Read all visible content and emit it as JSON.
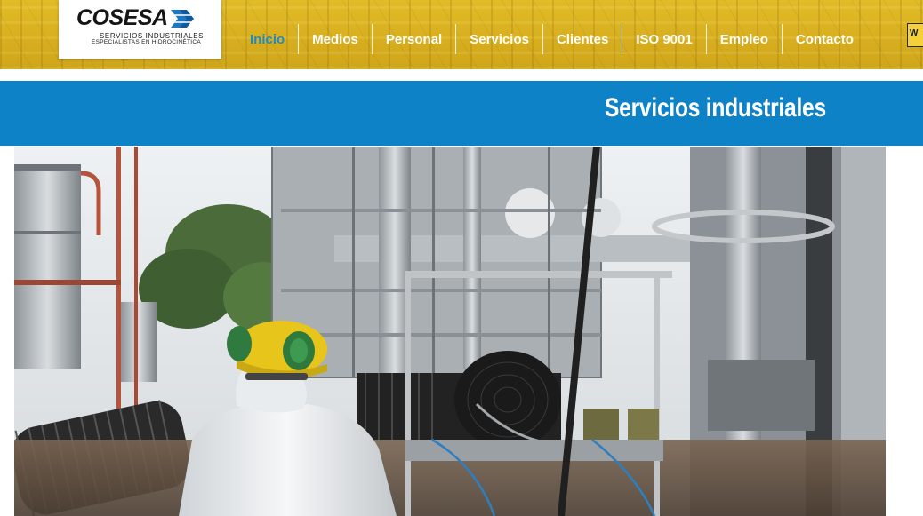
{
  "logo": {
    "name": "COSESA",
    "line1": "SERVICIOS INDUSTRIALES",
    "line2": "ESPECIALISTAS EN HIDROCINÉTICA"
  },
  "nav": {
    "items": [
      {
        "label": "Inicio",
        "active": true
      },
      {
        "label": "Medios",
        "active": false
      },
      {
        "label": "Personal",
        "active": false
      },
      {
        "label": "Servicios",
        "active": false
      },
      {
        "label": "Clientes",
        "active": false
      },
      {
        "label": "ISO 9001",
        "active": false
      },
      {
        "label": "Empleo",
        "active": false
      },
      {
        "label": "Contacto",
        "active": false
      }
    ]
  },
  "badge": {
    "text": "W"
  },
  "banner": {
    "title": "Servicios industriales"
  },
  "hero": {
    "icon": "industrial-plant-photo"
  },
  "colors": {
    "header_gold": "#d9b020",
    "banner_blue": "#0e82c6",
    "active_link": "#1a8bd1",
    "link_text": "#ffffff"
  }
}
